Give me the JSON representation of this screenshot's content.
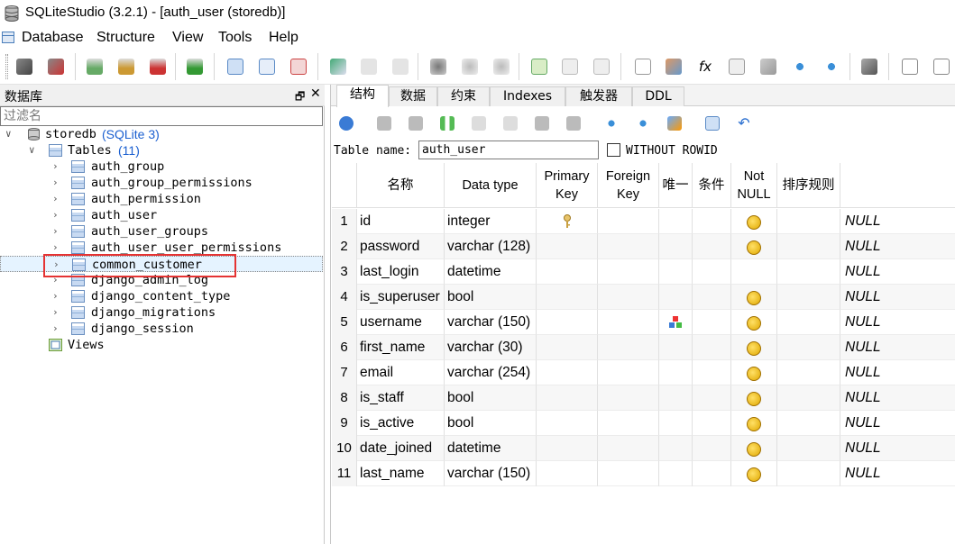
{
  "window": {
    "title": "SQLiteStudio (3.2.1) - [auth_user (storedb)]"
  },
  "menu": {
    "database": "Database",
    "structure": "Structure",
    "view": "View",
    "tools": "Tools",
    "help": "Help"
  },
  "db_panel": {
    "title": "数据库",
    "float_glyph": "🗗",
    "close_glyph": "✕",
    "filter_placeholder": "过滤名",
    "db_name": "storedb",
    "db_type": "(SQLite 3)",
    "tables_label": "Tables",
    "tables_count": "(11)",
    "tables": [
      "auth_group",
      "auth_group_permissions",
      "auth_permission",
      "auth_user",
      "auth_user_groups",
      "auth_user_user_permissions",
      "common_customer",
      "django_admin_log",
      "django_content_type",
      "django_migrations",
      "django_session"
    ],
    "views_label": "Views"
  },
  "tabs": [
    "结构",
    "数据",
    "约束",
    "Indexes",
    "触发器",
    "DDL"
  ],
  "table_editor": {
    "table_name_label": "Table name:",
    "table_name_value": "auth_user",
    "without_rowid_label": "WITHOUT ROWID"
  },
  "columns_header": {
    "name": "名称",
    "type": "Data type",
    "pk": "Primary\nKey",
    "fk": "Foreign\nKey",
    "unique": "唯一",
    "check": "条件",
    "notnull": "Not\nNULL",
    "collate": "排序规则",
    "default": ""
  },
  "columns": [
    {
      "n": "1",
      "name": "id",
      "type": "integer",
      "pk": true,
      "unique": false,
      "notnull": true,
      "default": "NULL"
    },
    {
      "n": "2",
      "name": "password",
      "type": "varchar (128)",
      "pk": false,
      "unique": false,
      "notnull": true,
      "default": "NULL"
    },
    {
      "n": "3",
      "name": "last_login",
      "type": "datetime",
      "pk": false,
      "unique": false,
      "notnull": false,
      "default": "NULL"
    },
    {
      "n": "4",
      "name": "is_superuser",
      "type": "bool",
      "pk": false,
      "unique": false,
      "notnull": true,
      "default": "NULL"
    },
    {
      "n": "5",
      "name": "username",
      "type": "varchar (150)",
      "pk": false,
      "unique": true,
      "notnull": true,
      "default": "NULL"
    },
    {
      "n": "6",
      "name": "first_name",
      "type": "varchar (30)",
      "pk": false,
      "unique": false,
      "notnull": true,
      "default": "NULL"
    },
    {
      "n": "7",
      "name": "email",
      "type": "varchar (254)",
      "pk": false,
      "unique": false,
      "notnull": true,
      "default": "NULL"
    },
    {
      "n": "8",
      "name": "is_staff",
      "type": "bool",
      "pk": false,
      "unique": false,
      "notnull": true,
      "default": "NULL"
    },
    {
      "n": "9",
      "name": "is_active",
      "type": "bool",
      "pk": false,
      "unique": false,
      "notnull": true,
      "default": "NULL"
    },
    {
      "n": "10",
      "name": "date_joined",
      "type": "datetime",
      "pk": false,
      "unique": false,
      "notnull": true,
      "default": "NULL"
    },
    {
      "n": "11",
      "name": "last_name",
      "type": "varchar (150)",
      "pk": false,
      "unique": false,
      "notnull": true,
      "default": "NULL"
    }
  ],
  "colors": {
    "highlight_box": "#e53333",
    "selection_bg": "#e5f3ff",
    "link_blue": "#1a5fd0"
  }
}
